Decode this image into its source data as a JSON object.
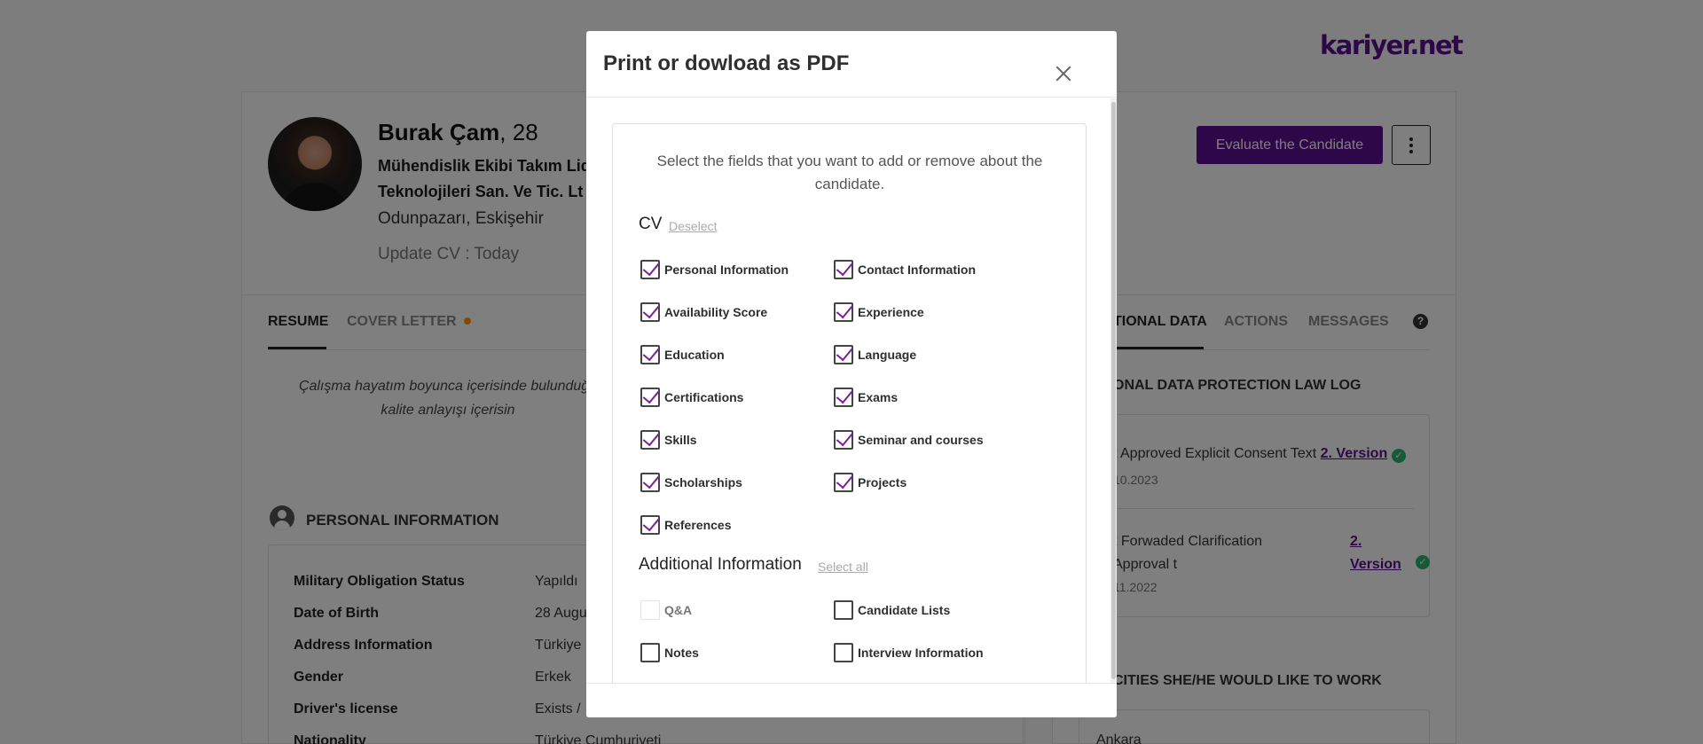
{
  "brand": {
    "logo_text": "kariyer.net",
    "color": "#5b0f8e"
  },
  "candidate": {
    "name": "Burak Çam",
    "age": ", 28",
    "job_line1": "Mühendislik Ekibi Takım Lid",
    "job_line2": "Teknolojileri San. Ve Tic. Lt",
    "location": "Odunpazarı, Eskişehir",
    "update": "Update CV : Today",
    "evaluate_label": "Evaluate the Candidate"
  },
  "left_tabs": {
    "resume": "RESUME",
    "cover_letter": "COVER LETTER"
  },
  "summary": {
    "line1": "Çalışma hayatım boyunca içerisinde bulunduğu",
    "line2": "kalite anlayışı içerisin"
  },
  "personal_info": {
    "title": "PERSONAL INFORMATION",
    "rows": [
      {
        "key": "Military Obligation Status",
        "value": "Yapıldı"
      },
      {
        "key": "Date of Birth",
        "value": "28 Augu"
      },
      {
        "key": "Address Information",
        "value": "Türkiye"
      },
      {
        "key": "Gender",
        "value": "Erkek"
      },
      {
        "key": "Driver's license",
        "value": "Exists /"
      },
      {
        "key": "Nationality",
        "value": "Türkiye Cumhuriyeti"
      }
    ]
  },
  "right_tabs": {
    "additional": "TIONAL DATA",
    "actions": "ACTIONS",
    "messages": "MESSAGES",
    "help": "?"
  },
  "kvkk": {
    "title": "ONAL DATA PROTECTION LAW LOG",
    "item1_text": "t Approved Explicit Consent Text",
    "item1_link": "2. Version",
    "item1_date": "10.2023",
    "item2_text": "t Forwaded Clarification Approval t",
    "item2_link": "2. Version",
    "item2_date": "11.2022"
  },
  "cities": {
    "title": "CITIES SHE/HE WOULD LIKE TO WORK",
    "value": "Ankara"
  },
  "modal": {
    "title": "Print or dowload as PDF",
    "intro": "Select the fields that you want to add or remove about the candidate.",
    "cv_section": {
      "title": "CV",
      "toggle": "Deselect",
      "items": [
        {
          "label": "Personal Information",
          "checked": true
        },
        {
          "label": "Contact Information",
          "checked": true
        },
        {
          "label": "Availability Score",
          "checked": true
        },
        {
          "label": "Experience",
          "checked": true
        },
        {
          "label": "Education",
          "checked": true
        },
        {
          "label": "Language",
          "checked": true
        },
        {
          "label": "Certifications",
          "checked": true
        },
        {
          "label": "Exams",
          "checked": true
        },
        {
          "label": "Skills",
          "checked": true
        },
        {
          "label": "Seminar and courses",
          "checked": true
        },
        {
          "label": "Scholarships",
          "checked": true
        },
        {
          "label": "Projects",
          "checked": true
        },
        {
          "label": "References",
          "checked": true
        }
      ]
    },
    "additional_section": {
      "title": "Additional Information",
      "toggle": "Select all",
      "items": [
        {
          "label": "Q&A",
          "checked": false,
          "disabled": true
        },
        {
          "label": "Candidate Lists",
          "checked": false
        },
        {
          "label": "Notes",
          "checked": false
        },
        {
          "label": "Interview Information",
          "checked": false
        }
      ]
    }
  }
}
